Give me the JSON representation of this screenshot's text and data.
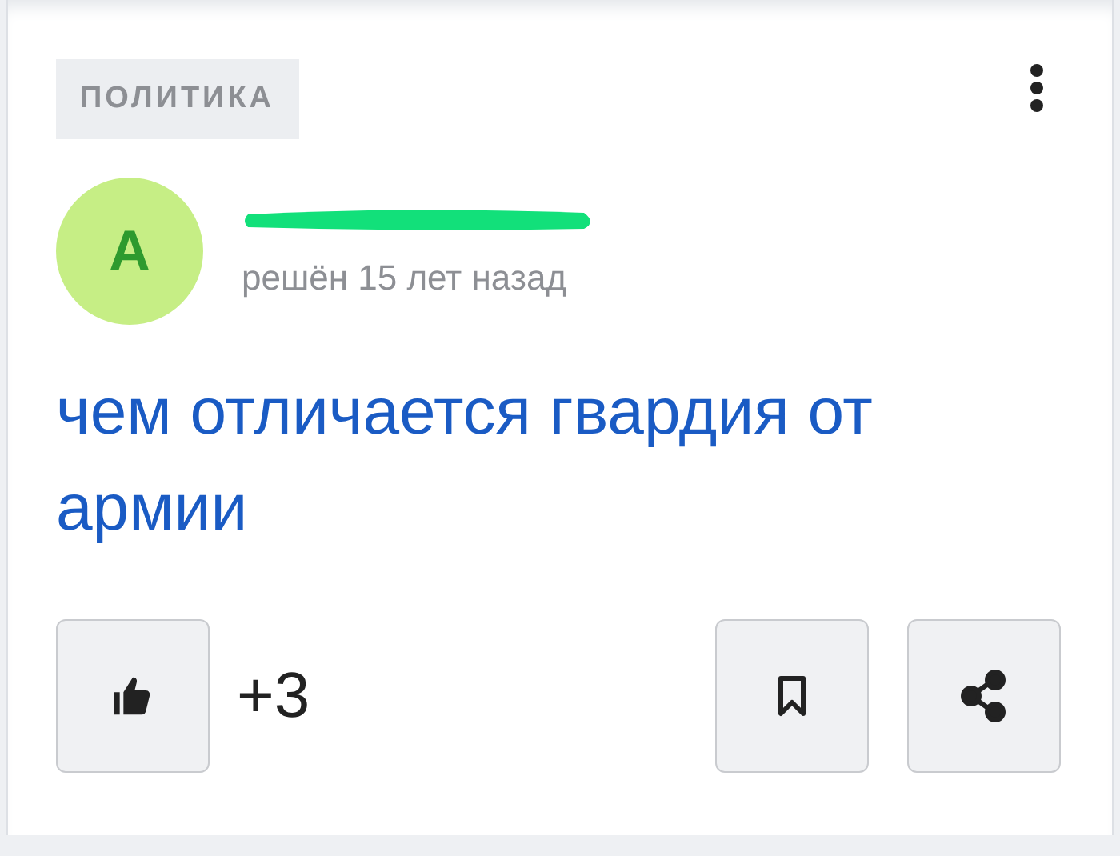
{
  "category": "ПОЛИТИКА",
  "author": {
    "avatar_letter": "A",
    "status": "решён 15 лет назад"
  },
  "question": "чем отличается гвардия от армии",
  "votes": "+3"
}
